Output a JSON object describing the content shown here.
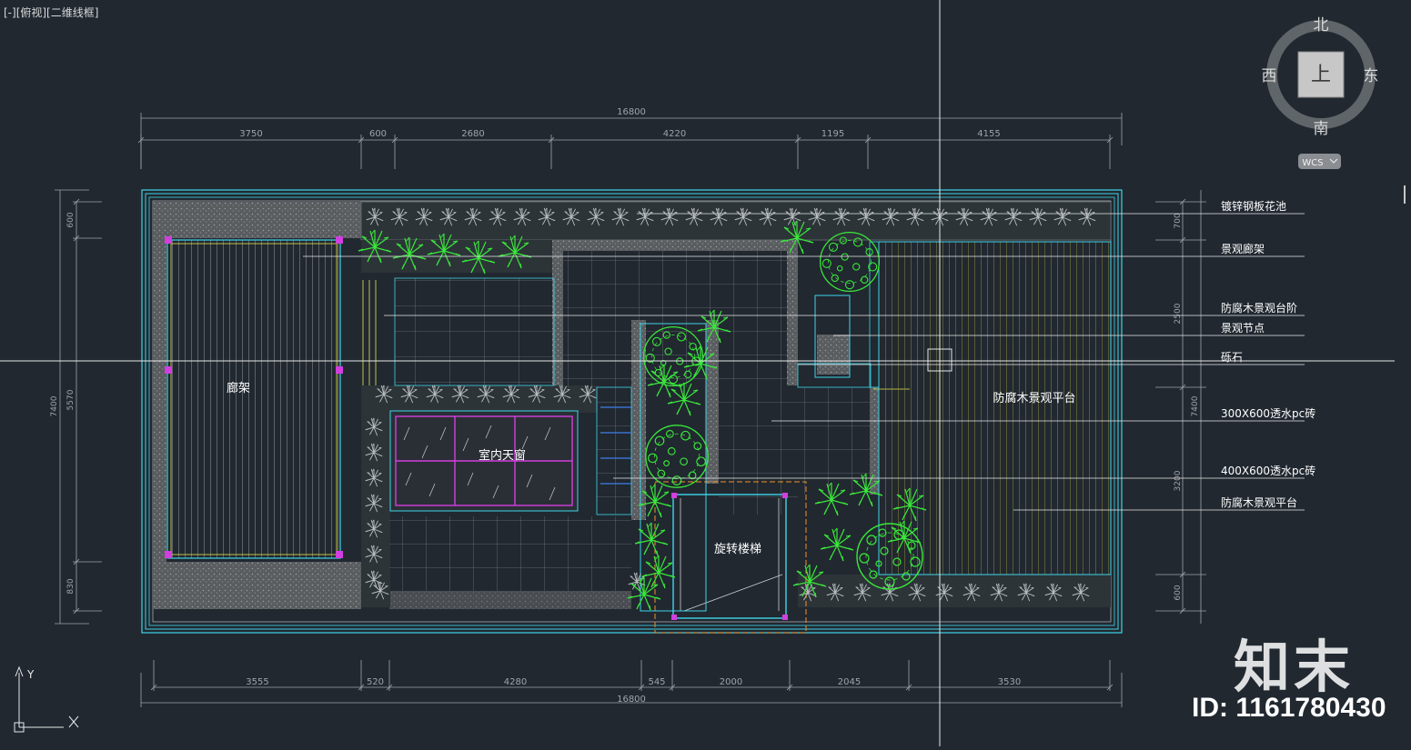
{
  "viewport": {
    "label": "[-][俯视][二维线框]"
  },
  "viewcube": {
    "north": "北",
    "south": "南",
    "west": "西",
    "east": "东",
    "face": "上",
    "wcs_label": "WCS"
  },
  "dims": {
    "top_total": "16800",
    "top": [
      "3750",
      "600",
      "2680",
      "4220",
      "1195",
      "4155"
    ],
    "bottom": [
      "3555",
      "520",
      "4280",
      "545",
      "2000",
      "2045",
      "3530"
    ],
    "bottom_total": "16800",
    "left_outer": "7400",
    "left": [
      "600",
      "5570",
      "830"
    ],
    "right_outer": "7400",
    "right": [
      "700",
      "2500",
      "3200",
      "600"
    ]
  },
  "areas": {
    "pergola": "廊架",
    "skylight": "室内天窗",
    "stair": "旋转楼梯",
    "deck": "防腐木景观平台"
  },
  "callouts": [
    "镀锌钢板花池",
    "景观廊架",
    "防腐木景观台阶",
    "景观节点",
    "砾石",
    "300X600透水pc砖",
    "400X600透水pc砖",
    "防腐木景观平台"
  ],
  "watermark": {
    "logo": "知末",
    "id": "ID: 1161780430"
  },
  "ucs": {
    "x": "X",
    "y": "Y"
  },
  "colors": {
    "bg": "#212830",
    "cyan": "#3fd5e8",
    "green": "#39e83a",
    "magenta": "#d23ee0",
    "yellow": "#e6e64a",
    "dim": "#a0a4a8"
  }
}
